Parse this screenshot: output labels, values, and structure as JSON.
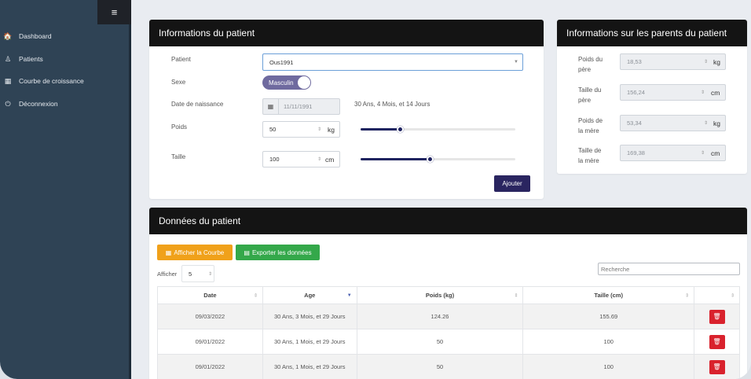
{
  "sidebar": {
    "menu_icon": "≡",
    "items": [
      {
        "label": "Dashboard",
        "icon": "🏠",
        "icon_name": "home-icon"
      },
      {
        "label": "Patients",
        "icon": "♙",
        "icon_name": "person-icon"
      },
      {
        "label": "Courbe de croissance",
        "icon": "▦",
        "icon_name": "chart-icon"
      },
      {
        "label": "Déconnexion",
        "icon": "⏻",
        "icon_name": "power-icon"
      }
    ]
  },
  "patient_info": {
    "title": "Informations du patient",
    "patient_label": "Patient",
    "patient_value": "Ous1991",
    "sexe_label": "Sexe",
    "sexe_value": "Masculin",
    "dob_label": "Date de naissance",
    "dob_value": "11/11/1991",
    "age_text": "30 Ans, 4 Mois, et 14 Jours",
    "poids_label": "Poids",
    "poids_value": "50",
    "poids_unit": "kg",
    "poids_slider": 0.26,
    "taille_label": "Taille",
    "taille_value": "100",
    "taille_unit": "cm",
    "taille_slider": 0.45,
    "add_button": "Ajouter"
  },
  "parents_info": {
    "title": "Informations sur les parents du patient",
    "fields": [
      {
        "label_l1": "Poids du",
        "label_l2": "père",
        "value": "18,53",
        "unit": "kg"
      },
      {
        "label_l1": "Taille du",
        "label_l2": "père",
        "value": "156,24",
        "unit": "cm"
      },
      {
        "label_l1": "Poids de",
        "label_l2": "la mère",
        "value": "53,34",
        "unit": "kg"
      },
      {
        "label_l1": "Taille de",
        "label_l2": "la mère",
        "value": "169,38",
        "unit": "cm"
      }
    ]
  },
  "data_section": {
    "title": "Données du patient",
    "btn_chart": "Afficher la Courbe",
    "btn_export": "Exporter les données",
    "show_label": "Afficher",
    "show_value": "5",
    "search_placeholder": "Recherche",
    "columns": [
      "Date",
      "Age",
      "Poids (kg)",
      "Taille (cm)"
    ],
    "rows": [
      {
        "date": "09/03/2022",
        "age": "30 Ans, 3 Mois, et 29 Jours",
        "poids": "124.26",
        "taille": "155.69"
      },
      {
        "date": "09/01/2022",
        "age": "30 Ans, 1 Mois, et 29 Jours",
        "poids": "50",
        "taille": "100"
      },
      {
        "date": "09/01/2022",
        "age": "30 Ans, 1 Mois, et 29 Jours",
        "poids": "50",
        "taille": "100"
      }
    ]
  },
  "colors": {
    "sidebar_bg": "#2f4355",
    "header_bg": "#141414",
    "primary": "#2a2560",
    "orange": "#f0a11a",
    "green": "#34a84a",
    "danger": "#d9222d"
  }
}
